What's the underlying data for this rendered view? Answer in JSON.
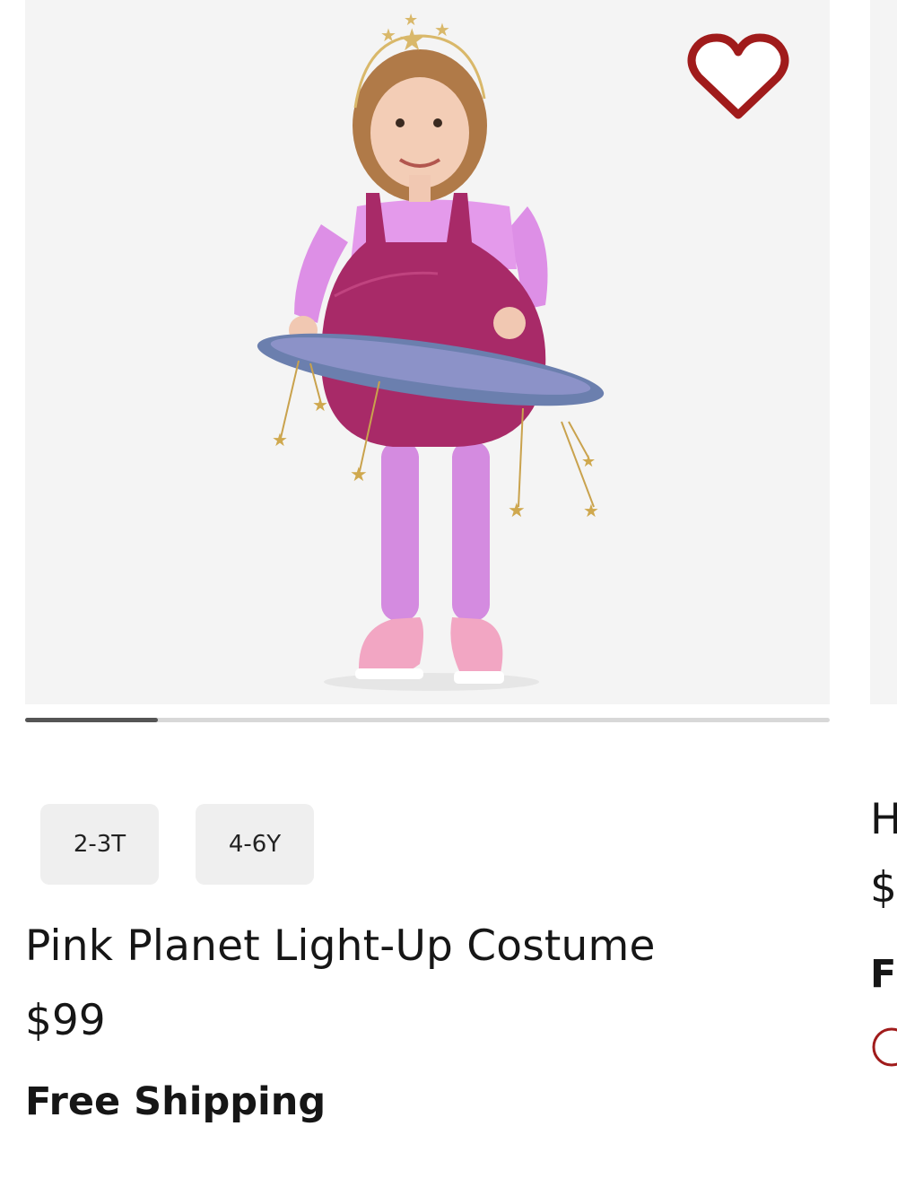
{
  "product": {
    "title": "Pink Planet Light-Up Costume",
    "price": "$99",
    "shipping": "Free Shipping",
    "sizes": [
      "2-3T",
      "4-6Y"
    ],
    "favorite_icon": "heart-outline-icon",
    "carousel_progress": 0.165
  },
  "next_product": {
    "title_partial": "H",
    "price_partial": "$",
    "shipping_partial": "F"
  },
  "colors": {
    "accent": "#a01b1b",
    "photo_bg": "#f4f4f4",
    "chip_bg": "#efefef",
    "track": "#d8d8d8",
    "thumb": "#555555"
  }
}
